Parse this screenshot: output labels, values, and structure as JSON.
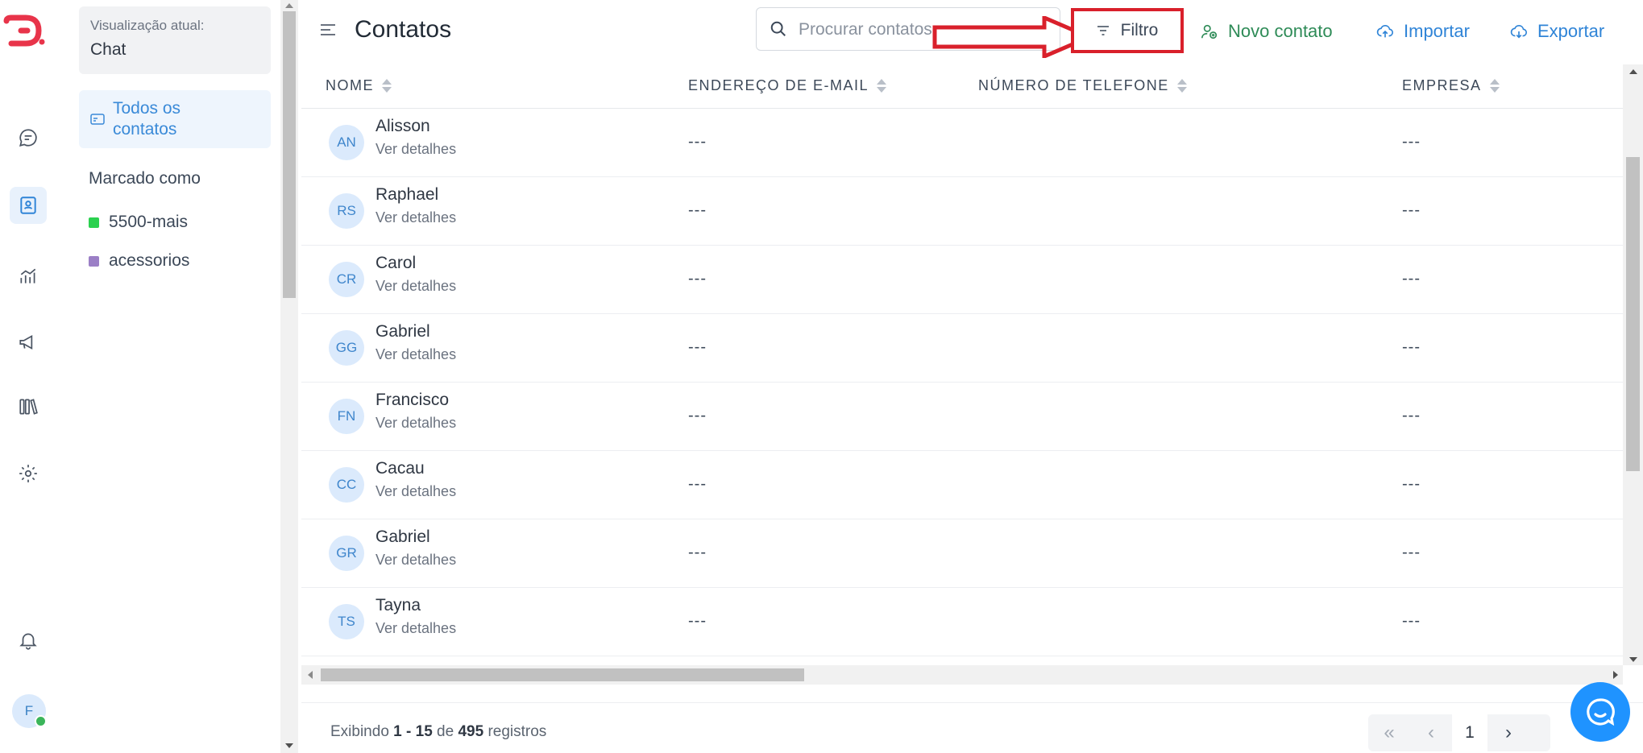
{
  "rail": {
    "icons": [
      "logo-icon",
      "chat-icon",
      "contacts-icon",
      "reports-icon",
      "campaigns-icon",
      "library-icon",
      "settings-icon",
      "notifications-icon"
    ],
    "avatar_initial": "F",
    "accent": "#e8344a"
  },
  "sidebar": {
    "view_caption": "Visualização atual:",
    "view_value": "Chat",
    "all_contacts_label": "Todos os contatos",
    "tagged_heading": "Marcado como",
    "tags": [
      {
        "label": "5500-mais",
        "color": "#2bd14f"
      },
      {
        "label": "acessorios",
        "color": "#9b7fc6"
      }
    ]
  },
  "header": {
    "title": "Contatos",
    "search_placeholder": "Procurar contatos",
    "filter_label": "Filtro",
    "new_contact_label": "Novo contato",
    "import_label": "Importar",
    "export_label": "Exportar",
    "highlight_color": "#d9202b"
  },
  "table": {
    "columns": [
      "NOME",
      "ENDEREÇO DE E-MAIL",
      "NÚMERO DE TELEFONE",
      "EMPRESA"
    ],
    "rows": [
      {
        "initials": "AN",
        "name": "Alisson",
        "detail": "Ver detalhes",
        "email": "---",
        "phone": "",
        "company": "---"
      },
      {
        "initials": "RS",
        "name": "Raphael",
        "detail": "Ver detalhes",
        "email": "---",
        "phone": "",
        "company": "---"
      },
      {
        "initials": "CR",
        "name": "Carol",
        "detail": "Ver detalhes",
        "email": "---",
        "phone": "",
        "company": "---"
      },
      {
        "initials": "GG",
        "name": "Gabriel",
        "detail": "Ver detalhes",
        "email": "---",
        "phone": "",
        "company": "---"
      },
      {
        "initials": "FN",
        "name": "Francisco",
        "detail": "Ver detalhes",
        "email": "---",
        "phone": "",
        "company": "---"
      },
      {
        "initials": "CC",
        "name": "Cacau",
        "detail": "Ver detalhes",
        "email": "---",
        "phone": "",
        "company": "---"
      },
      {
        "initials": "GR",
        "name": "Gabriel",
        "detail": "Ver detalhes",
        "email": "---",
        "phone": "",
        "company": "---"
      },
      {
        "initials": "TS",
        "name": "Tayna",
        "detail": "Ver detalhes",
        "email": "---",
        "phone": "",
        "company": "---"
      }
    ]
  },
  "footer": {
    "prefix": "Exibindo ",
    "range": "1 - 15",
    "middle": " de ",
    "total": "495",
    "suffix": " registros",
    "pagination": {
      "first": "«",
      "prev": "‹",
      "current_page": "1",
      "next": "›"
    }
  }
}
